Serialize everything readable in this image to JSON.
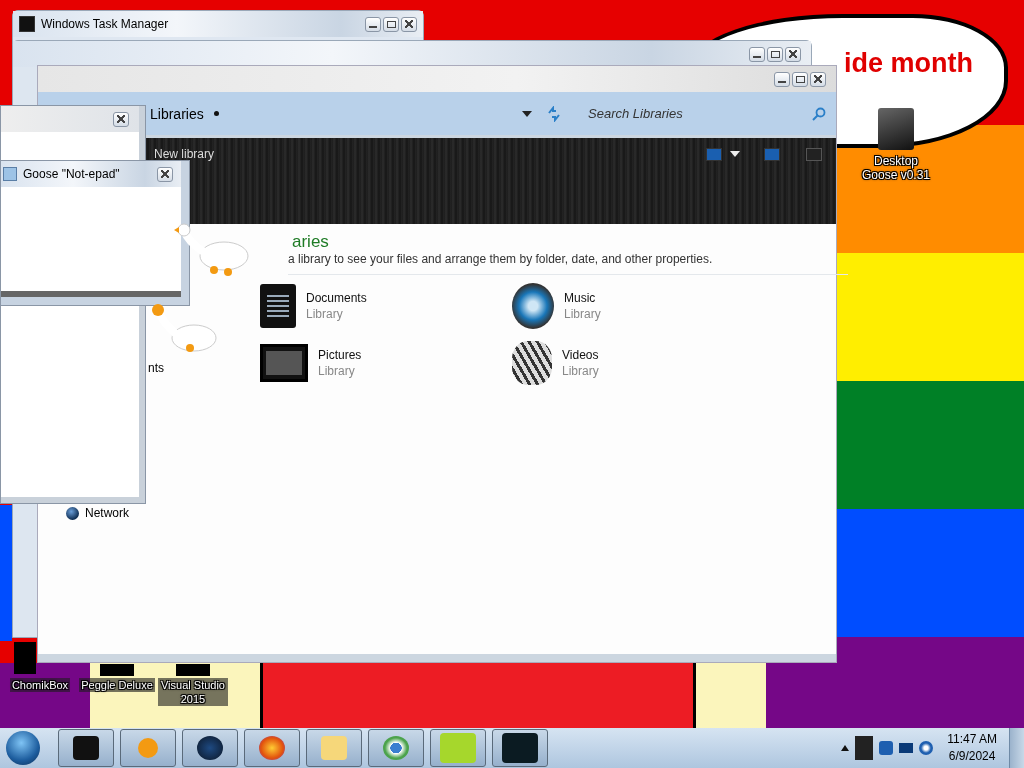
{
  "wallpaper": {
    "caption": "ide month"
  },
  "desktop_icons": [
    {
      "label": "Desktop Goose v0.31",
      "kind": "goose"
    },
    {
      "label": "ChomikBox",
      "kind": "chomik"
    },
    {
      "label": "Peggle Deluxe",
      "kind": "peggle"
    },
    {
      "label": "Visual Studio 2015",
      "kind": "studio"
    }
  ],
  "task_manager": {
    "title": "Windows Task Manager"
  },
  "explorer": {
    "breadcrumb": "Libraries",
    "search": {
      "placeholder": "Search Libraries"
    },
    "toolbar": {
      "new_library": "New library"
    },
    "heading": "aries",
    "description": "a library to see your files and arrange them by folder, date, and other properties.",
    "libraries": [
      {
        "name": "Documents",
        "type": "Library",
        "kind": "documents"
      },
      {
        "name": "Music",
        "type": "Library",
        "kind": "music"
      },
      {
        "name": "Pictures",
        "type": "Library",
        "kind": "pictures"
      },
      {
        "name": "Videos",
        "type": "Library",
        "kind": "videos"
      }
    ],
    "nav_items": [
      {
        "label": "nts",
        "kind": "plain"
      },
      {
        "label": "Network",
        "kind": "network"
      }
    ]
  },
  "goose_notepad": {
    "title": "Goose \"Not-epad\""
  },
  "taskbar": {
    "time": "11:47 AM",
    "date": "6/9/2024"
  }
}
